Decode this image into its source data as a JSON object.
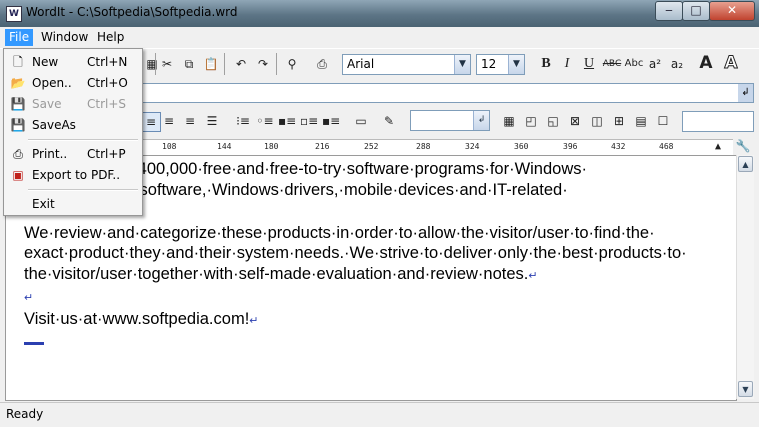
{
  "window": {
    "title": "WordIt - C:\\Softpedia\\Softpedia.wrd",
    "controls": {
      "minimize": "‒",
      "maximize": "□",
      "close": "✕"
    }
  },
  "menubar": {
    "items": [
      {
        "label": "File",
        "active": true
      },
      {
        "label": "Window",
        "active": false
      },
      {
        "label": "Help",
        "active": false
      }
    ]
  },
  "file_menu": {
    "new": {
      "label": "New",
      "shortcut": "Ctrl+N",
      "icon": "new-document-icon"
    },
    "open": {
      "label": "Open..",
      "shortcut": "Ctrl+O",
      "icon": "open-folder-icon"
    },
    "save": {
      "label": "Save",
      "shortcut": "Ctrl+S",
      "icon": "save-disk-icon",
      "disabled": true
    },
    "saveas": {
      "label": "SaveAs",
      "icon": "save-as-icon"
    },
    "print": {
      "label": "Print..",
      "shortcut": "Ctrl+P",
      "icon": "printer-icon"
    },
    "export_pdf": {
      "label": "Export to PDF..",
      "icon": "pdf-icon"
    },
    "exit": {
      "label": "Exit"
    }
  },
  "toolbar": {
    "font_name": "Arial",
    "font_size": "12",
    "bold": "B",
    "italic": "I",
    "underline": "U",
    "strike": "ABC",
    "smallcaps": "Abc",
    "superscript": "a²",
    "subscript": "a₂",
    "font_color": "A",
    "outline": "A"
  },
  "ruler": {
    "ticks": [
      "108",
      "144",
      "180",
      "216",
      "252",
      "288",
      "324",
      "360",
      "396",
      "432",
      "468"
    ]
  },
  "document": {
    "paragraphs": [
      "...brary·of·over·400,000·free·and·free-to-try·software·programs·for·Windows·",
      "...·games,·Mac·software,·Windows·drivers,·mobile·devices·and·IT-related·",
      "",
      "We·review·and·categorize·these·products·in·order·to·allow·the·visitor/user·to·find·the·",
      "exact·product·they·and·their·system·needs.·We·strive·to·deliver·only·the·best·products·to·",
      "the·visitor/user·together·with·self-made·evaluation·and·review·notes.",
      "",
      "Visit·us·at·www.softpedia.com!"
    ],
    "pilcrow": "↵"
  },
  "status": {
    "text": "Ready"
  },
  "colors": {
    "menu_highlight": "#3399ff",
    "pilcrow": "#2b3fb0"
  }
}
